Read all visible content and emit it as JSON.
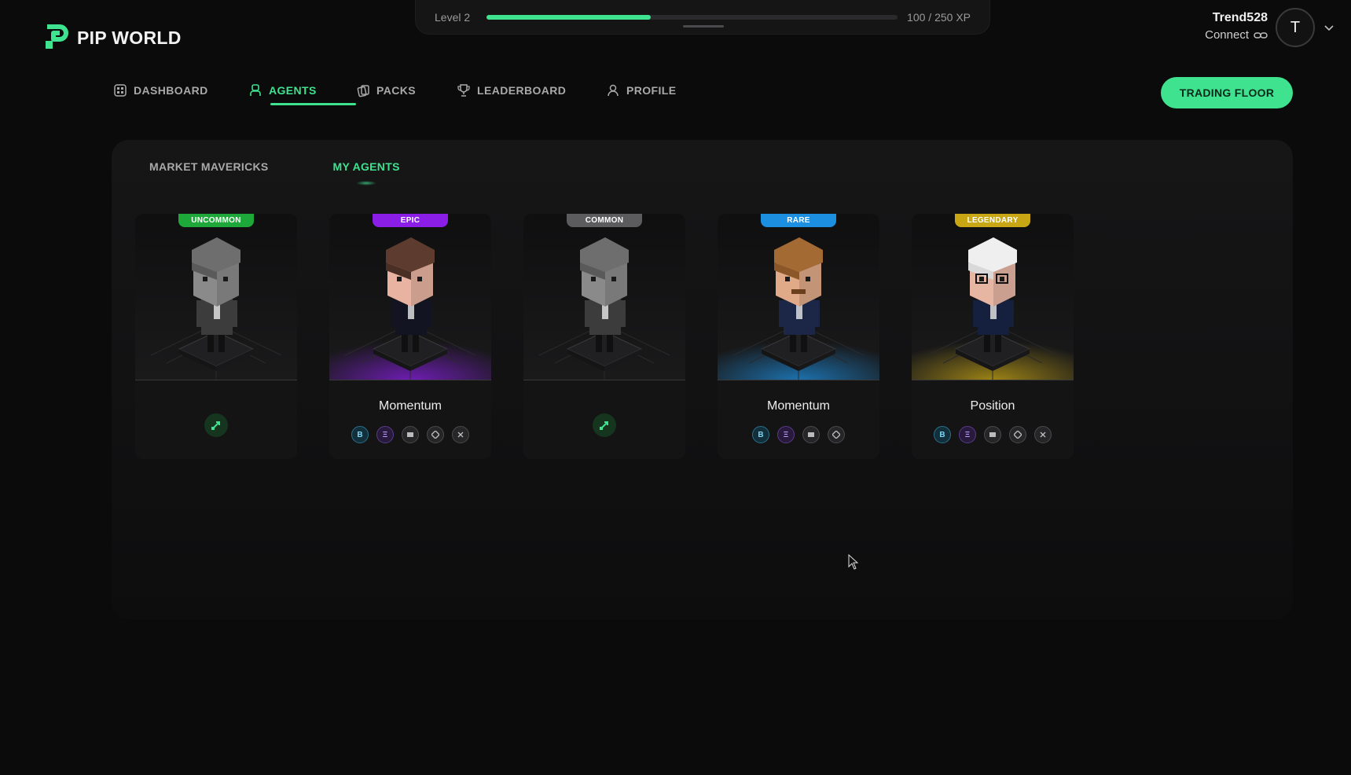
{
  "xp": {
    "level_label": "Level 2",
    "amount_label": "100 / 250 XP",
    "progress": 0.4
  },
  "brand": {
    "name": "PIP WORLD",
    "icon": "pip-logo-icon",
    "accent": "#3ee28f"
  },
  "user": {
    "name": "Trend528",
    "connect_label": "Connect",
    "avatar_initial": "T"
  },
  "nav": {
    "items": [
      {
        "label": "DASHBOARD",
        "icon": "dashboard-icon",
        "active": false
      },
      {
        "label": "AGENTS",
        "icon": "agent-icon",
        "active": true
      },
      {
        "label": "PACKS",
        "icon": "packs-icon",
        "active": false
      },
      {
        "label": "LEADERBOARD",
        "icon": "trophy-icon",
        "active": false
      },
      {
        "label": "PROFILE",
        "icon": "profile-icon",
        "active": false
      }
    ],
    "trading_floor_label": "TRADING FLOOR"
  },
  "tabs": [
    {
      "label": "MARKET MAVERICKS",
      "active": false
    },
    {
      "label": "MY AGENTS",
      "active": true
    }
  ],
  "agents": [
    {
      "rarity": "UNCOMMON",
      "rarity_color": "#1fa83a",
      "strategy": "",
      "coins": [],
      "action_icon": "assign-strategy-icon",
      "glow": "none",
      "skin": "gray"
    },
    {
      "rarity": "EPIC",
      "rarity_color": "#8a1ee6",
      "strategy": "Momentum",
      "coins": [
        "btc",
        "eth",
        "gen",
        "gen",
        "gen"
      ],
      "glow": "#8a1ee6",
      "skin": "suit"
    },
    {
      "rarity": "COMMON",
      "rarity_color": "#5c5c5e",
      "strategy": "",
      "coins": [],
      "action_icon": "assign-strategy-icon",
      "glow": "none",
      "skin": "gray"
    },
    {
      "rarity": "RARE",
      "rarity_color": "#1d8fe0",
      "strategy": "Momentum",
      "coins": [
        "btc",
        "eth",
        "gen",
        "gen"
      ],
      "glow": "#1d8fe0",
      "skin": "curly"
    },
    {
      "rarity": "LEGENDARY",
      "rarity_color": "#c9a714",
      "strategy": "Position",
      "coins": [
        "btc",
        "eth",
        "gen",
        "gen",
        "gen"
      ],
      "glow": "#c9a714",
      "skin": "elder"
    }
  ]
}
